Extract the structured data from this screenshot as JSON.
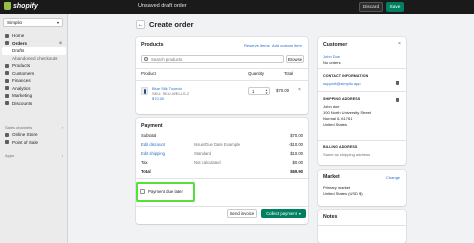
{
  "topbar": {
    "brand": "shopify",
    "status": "Unsaved draft order",
    "discard": "Discard",
    "save": "Save"
  },
  "sidebar": {
    "store": "Simplio",
    "items": [
      {
        "label": "Home",
        "icon": "home-icon"
      },
      {
        "label": "Orders",
        "icon": "orders-icon",
        "badge": "6"
      },
      {
        "label": "Drafts",
        "sub": true,
        "active": true
      },
      {
        "label": "Abandoned checkouts",
        "sub": true
      },
      {
        "label": "Products",
        "icon": "tag-icon"
      },
      {
        "label": "Customers",
        "icon": "person-icon"
      },
      {
        "label": "Finances",
        "icon": "finances-icon"
      },
      {
        "label": "Analytics",
        "icon": "chart-icon"
      },
      {
        "label": "Marketing",
        "icon": "target-icon"
      },
      {
        "label": "Discounts",
        "icon": "discount-icon"
      }
    ],
    "sales_channels_label": "Sales channels",
    "channels": [
      {
        "label": "Online Store",
        "icon": "store-icon"
      },
      {
        "label": "Point of Sale",
        "icon": "pos-icon"
      }
    ],
    "apps_label": "Apps"
  },
  "page": {
    "title": "Create order"
  },
  "products": {
    "title": "Products",
    "reserve_link": "Reserve items",
    "add_custom_link": "Add custom item",
    "search_placeholder": "Search products",
    "browse": "Browse",
    "columns": [
      "Product",
      "Quantity",
      "Total"
    ],
    "line": {
      "name": "Blue Silk Tuxedo",
      "sku": "SKU: SKU-WELLS-2",
      "price": "$70.00",
      "quantity": "1",
      "total": "$70.00"
    }
  },
  "payment": {
    "title": "Payment",
    "rows": [
      {
        "label": "Subtotal",
        "note": "",
        "value": "$70.00"
      },
      {
        "label": "Edit discount",
        "note": "Issue/Due Date Example",
        "value": "-$10.00",
        "link": true
      },
      {
        "label": "Edit shipping",
        "note": "Standard",
        "value": "$10.00",
        "link": true
      },
      {
        "label": "Tax",
        "note": "Not calculated",
        "value": "$0.00"
      },
      {
        "label": "Total",
        "note": "",
        "value": "$69.90",
        "bold": true
      }
    ],
    "due_later": "Payment due later",
    "send_invoice": "Send invoice",
    "collect_payment": "Collect payment"
  },
  "customer": {
    "title": "Customer",
    "name": "John Doe",
    "orders": "No orders",
    "contact_title": "CONTACT INFORMATION",
    "email": "support@simplio.app",
    "shipping_title": "SHIPPING ADDRESS",
    "address": [
      "John doe",
      "100 North University Street",
      "Normal IL 61761",
      "United States"
    ],
    "billing_title": "BILLING ADDRESS",
    "billing_note": "Same as shipping address"
  },
  "market": {
    "title": "Market",
    "change": "Change",
    "lines": [
      "Primary market",
      "United States (USD $)"
    ]
  },
  "notes": {
    "title": "Notes"
  }
}
